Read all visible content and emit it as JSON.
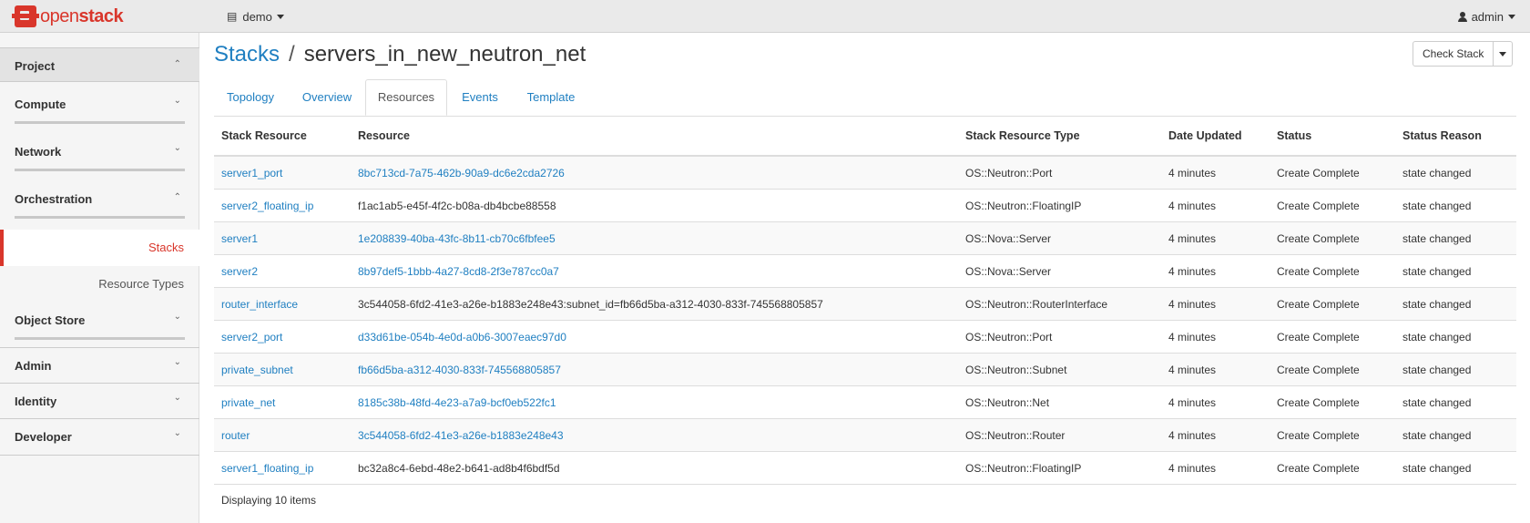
{
  "navbar": {
    "brand": {
      "part1": "open",
      "part2": "stack"
    },
    "project": "demo",
    "user": "admin"
  },
  "sidebar": {
    "groups": [
      {
        "label": "Project",
        "expanded": true
      },
      {
        "label": "Compute"
      },
      {
        "label": "Network"
      },
      {
        "label": "Orchestration",
        "expanded": true
      },
      {
        "label": "Object Store"
      },
      {
        "label": "Admin"
      },
      {
        "label": "Identity"
      },
      {
        "label": "Developer"
      }
    ],
    "panels": [
      {
        "label": "Stacks",
        "active": true
      },
      {
        "label": "Resource Types"
      }
    ]
  },
  "main": {
    "breadcrumb": "Stacks",
    "separator": "/",
    "title": "servers_in_new_neutron_net",
    "action_button": "Check Stack",
    "tabs": [
      "Topology",
      "Overview",
      "Resources",
      "Events",
      "Template"
    ],
    "active_tab": "Resources"
  },
  "table": {
    "headers": [
      "Stack Resource",
      "Resource",
      "Stack Resource Type",
      "Date Updated",
      "Status",
      "Status Reason"
    ],
    "rows": [
      {
        "name": "server1_port",
        "resource": "8bc713cd-7a75-462b-90a9-dc6e2cda2726",
        "linked": true,
        "type": "OS::Neutron::Port",
        "updated": "4 minutes",
        "status": "Create Complete",
        "reason": "state changed"
      },
      {
        "name": "server2_floating_ip",
        "resource": "f1ac1ab5-e45f-4f2c-b08a-db4bcbe88558",
        "linked": false,
        "type": "OS::Neutron::FloatingIP",
        "updated": "4 minutes",
        "status": "Create Complete",
        "reason": "state changed"
      },
      {
        "name": "server1",
        "resource": "1e208839-40ba-43fc-8b11-cb70c6fbfee5",
        "linked": true,
        "type": "OS::Nova::Server",
        "updated": "4 minutes",
        "status": "Create Complete",
        "reason": "state changed"
      },
      {
        "name": "server2",
        "resource": "8b97def5-1bbb-4a27-8cd8-2f3e787cc0a7",
        "linked": true,
        "type": "OS::Nova::Server",
        "updated": "4 minutes",
        "status": "Create Complete",
        "reason": "state changed"
      },
      {
        "name": "router_interface",
        "resource": "3c544058-6fd2-41e3-a26e-b1883e248e43:subnet_id=fb66d5ba-a312-4030-833f-745568805857",
        "linked": false,
        "type": "OS::Neutron::RouterInterface",
        "updated": "4 minutes",
        "status": "Create Complete",
        "reason": "state changed"
      },
      {
        "name": "server2_port",
        "resource": "d33d61be-054b-4e0d-a0b6-3007eaec97d0",
        "linked": true,
        "type": "OS::Neutron::Port",
        "updated": "4 minutes",
        "status": "Create Complete",
        "reason": "state changed"
      },
      {
        "name": "private_subnet",
        "resource": "fb66d5ba-a312-4030-833f-745568805857",
        "linked": true,
        "type": "OS::Neutron::Subnet",
        "updated": "4 minutes",
        "status": "Create Complete",
        "reason": "state changed"
      },
      {
        "name": "private_net",
        "resource": "8185c38b-48fd-4e23-a7a9-bcf0eb522fc1",
        "linked": true,
        "type": "OS::Neutron::Net",
        "updated": "4 minutes",
        "status": "Create Complete",
        "reason": "state changed"
      },
      {
        "name": "router",
        "resource": "3c544058-6fd2-41e3-a26e-b1883e248e43",
        "linked": true,
        "type": "OS::Neutron::Router",
        "updated": "4 minutes",
        "status": "Create Complete",
        "reason": "state changed"
      },
      {
        "name": "server1_floating_ip",
        "resource": "bc32a8c4-6ebd-48e2-b641-ad8b4f6bdf5d",
        "linked": false,
        "type": "OS::Neutron::FloatingIP",
        "updated": "4 minutes",
        "status": "Create Complete",
        "reason": "state changed"
      }
    ],
    "footer": "Displaying 10 items"
  },
  "colors": {
    "brand": "#d9362b",
    "link": "#1f7fc1",
    "sidebar_bg": "#f5f5f5",
    "navbar_bg": "#eaeaea"
  },
  "icons": {
    "project": "folder-icon",
    "user": "user-icon",
    "expand": "chevron-down-icon",
    "collapse": "chevron-up-icon"
  }
}
